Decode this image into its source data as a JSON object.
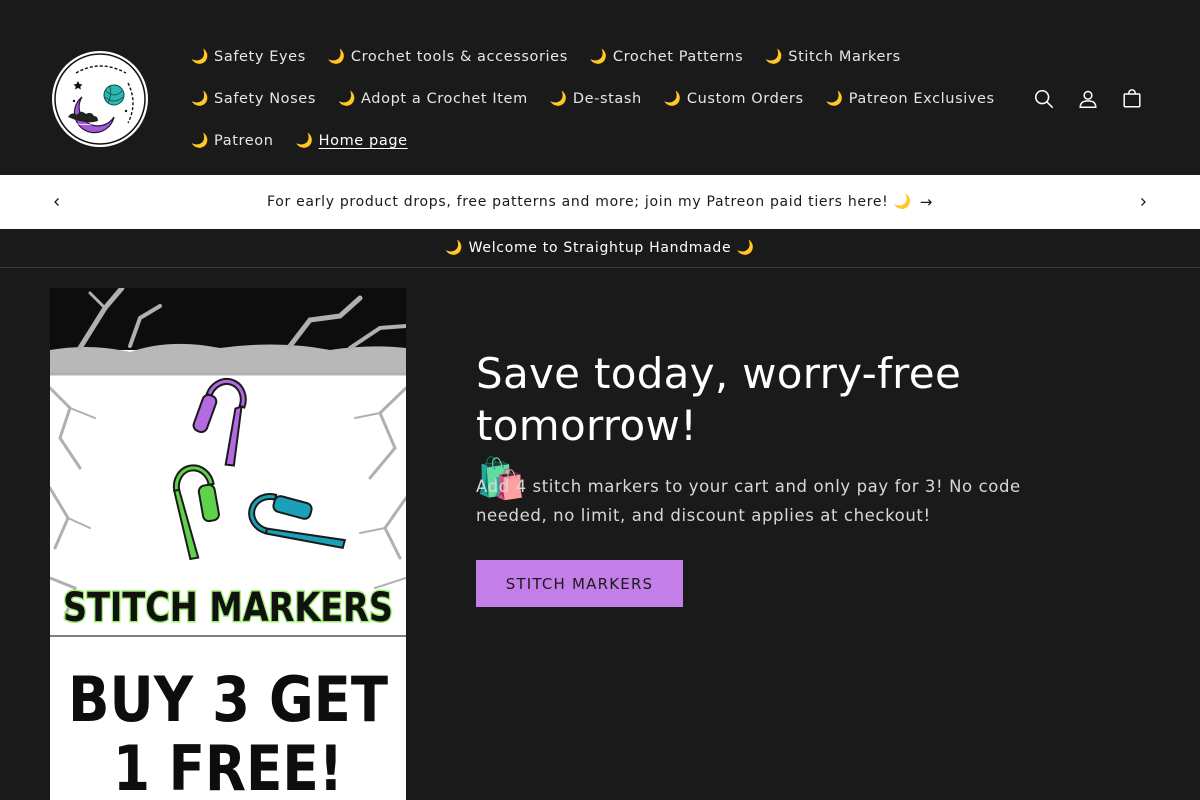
{
  "header": {
    "logo_alt": "Straightup Handmade",
    "nav_rows": [
      [
        {
          "icon": "🌙",
          "label": "Safety Eyes"
        },
        {
          "icon": "🌙",
          "label": "Crochet tools & accessories"
        },
        {
          "icon": "🌙",
          "label": "Crochet Patterns"
        },
        {
          "icon": "🌙",
          "label": "Stitch Markers"
        }
      ],
      [
        {
          "icon": "🌙",
          "label": "Safety Noses"
        },
        {
          "icon": "🌙",
          "label": "Adopt a Crochet Item"
        },
        {
          "icon": "🌙",
          "label": "De-stash"
        },
        {
          "icon": "🌙",
          "label": "Custom Orders"
        },
        {
          "icon": "🌙",
          "label": "Patreon Exclusives"
        }
      ],
      [
        {
          "icon": "🌙",
          "label": "Patreon"
        },
        {
          "icon": "🌙",
          "label": "Home page",
          "active": true
        }
      ]
    ],
    "icons": [
      "search-icon",
      "account-icon",
      "cart-icon"
    ]
  },
  "announcement": {
    "text": "For early product drops, free patterns and more; join my Patreon paid tiers here! 🌙",
    "arrow": "→"
  },
  "welcome": {
    "text": "🌙 Welcome to Straightup Handmade 🌙"
  },
  "hero": {
    "image_text_1": "STITCH MARKERS",
    "image_text_2": "BUY 3 GET",
    "image_text_3": "1 FREE!",
    "title": "Save today, worry-free tomorrow!",
    "title_emoji": "🛍️",
    "description": "Add 4 stitch markers to your cart and only pay for 3! No code needed, no limit, and discount applies at checkout!",
    "button_label": "STITCH MARKERS"
  },
  "colors": {
    "background": "#1a1a1a",
    "accent_button": "#c47ee8",
    "marker_purple": "#b46ae0",
    "marker_green": "#5fd14a",
    "marker_teal": "#1aa0b8"
  }
}
